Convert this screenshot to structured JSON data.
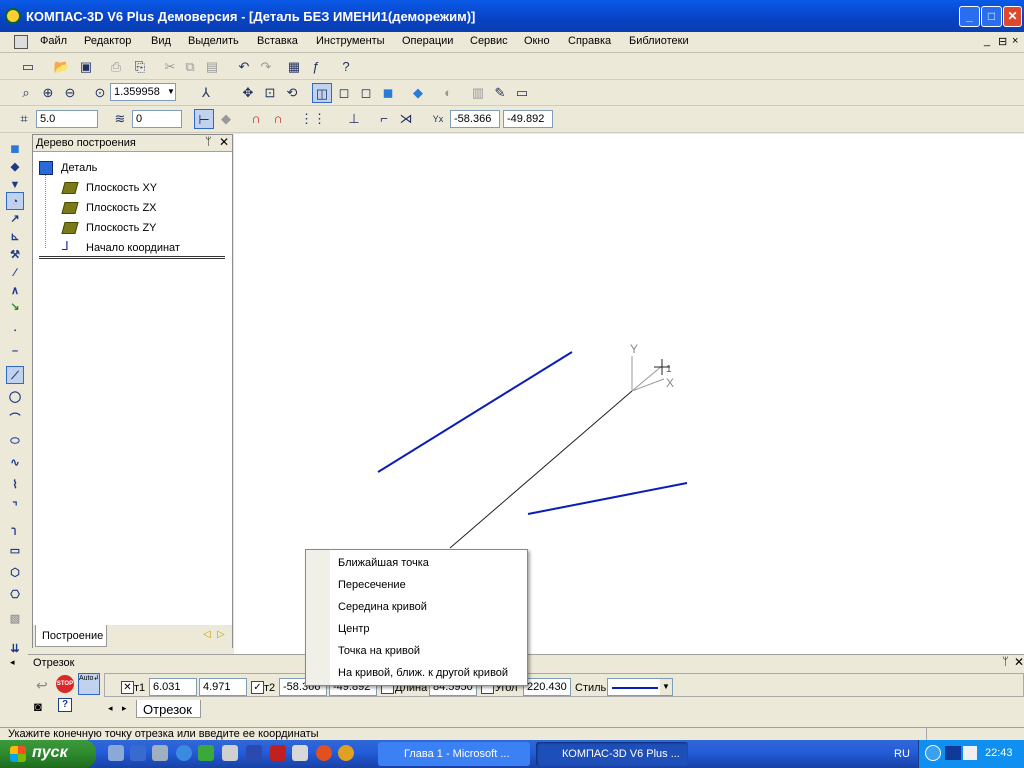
{
  "window": {
    "title": "КОМПАС-3D V6 Plus Демоверсия - [Деталь БЕЗ ИМЕНИ1(деморежим)]",
    "minimize": "_",
    "maximize": "□",
    "close": "✕"
  },
  "menubar": {
    "items": [
      "Файл",
      "Редактор",
      "Вид",
      "Выделить",
      "Вставка",
      "Инструменты",
      "Операции",
      "Сервис",
      "Окно",
      "Справка",
      "Библиотеки"
    ],
    "doc_controls": [
      "_",
      "⊟",
      "×"
    ]
  },
  "toolbar2": {
    "zoom_value": "1.359958"
  },
  "toolbar3": {
    "step_value": "5.0",
    "layer_value": "0",
    "coord_x": "-58.366",
    "coord_y": "-49.892"
  },
  "tree_panel": {
    "title": "Дерево построения",
    "root": "Деталь",
    "items": [
      "Плоскость XY",
      "Плоскость ZX",
      "Плоскость ZY",
      "Начало координат"
    ],
    "tab": "Построение"
  },
  "canvas": {
    "axis_y_label": "Y",
    "axis_x_label": "X",
    "axis_mark": "1",
    "line_color": "#0a1eb5"
  },
  "param_panel": {
    "title": "Отрезок",
    "t1_label": "т1",
    "t1_x": "6.031",
    "t1_y": "4.971",
    "t2_label": "т2",
    "t2_x": "-58.366",
    "t2_y": "-49.892",
    "length_label": "Длина",
    "length_value": "84.5950",
    "angle_label": "Угол",
    "angle_value": "220.430",
    "style_label": "Стиль",
    "tab": "Отрезок",
    "stop_label": "STOP",
    "auto_label": "Auto"
  },
  "context_menu": {
    "items": [
      "Ближайшая точка",
      "Пересечение",
      "Середина кривой",
      "Центр",
      "Точка на кривой",
      "На кривой, ближ. к другой кривой"
    ]
  },
  "statusbar": {
    "hint": "Укажите конечную точку отрезка или введите ее координаты"
  },
  "taskbar": {
    "start_label": "пуск",
    "tasks": [
      "Глава 1 - Microsoft ...",
      "КОМПАС-3D V6 Plus ..."
    ],
    "lang": "RU",
    "clock": "22:43"
  }
}
